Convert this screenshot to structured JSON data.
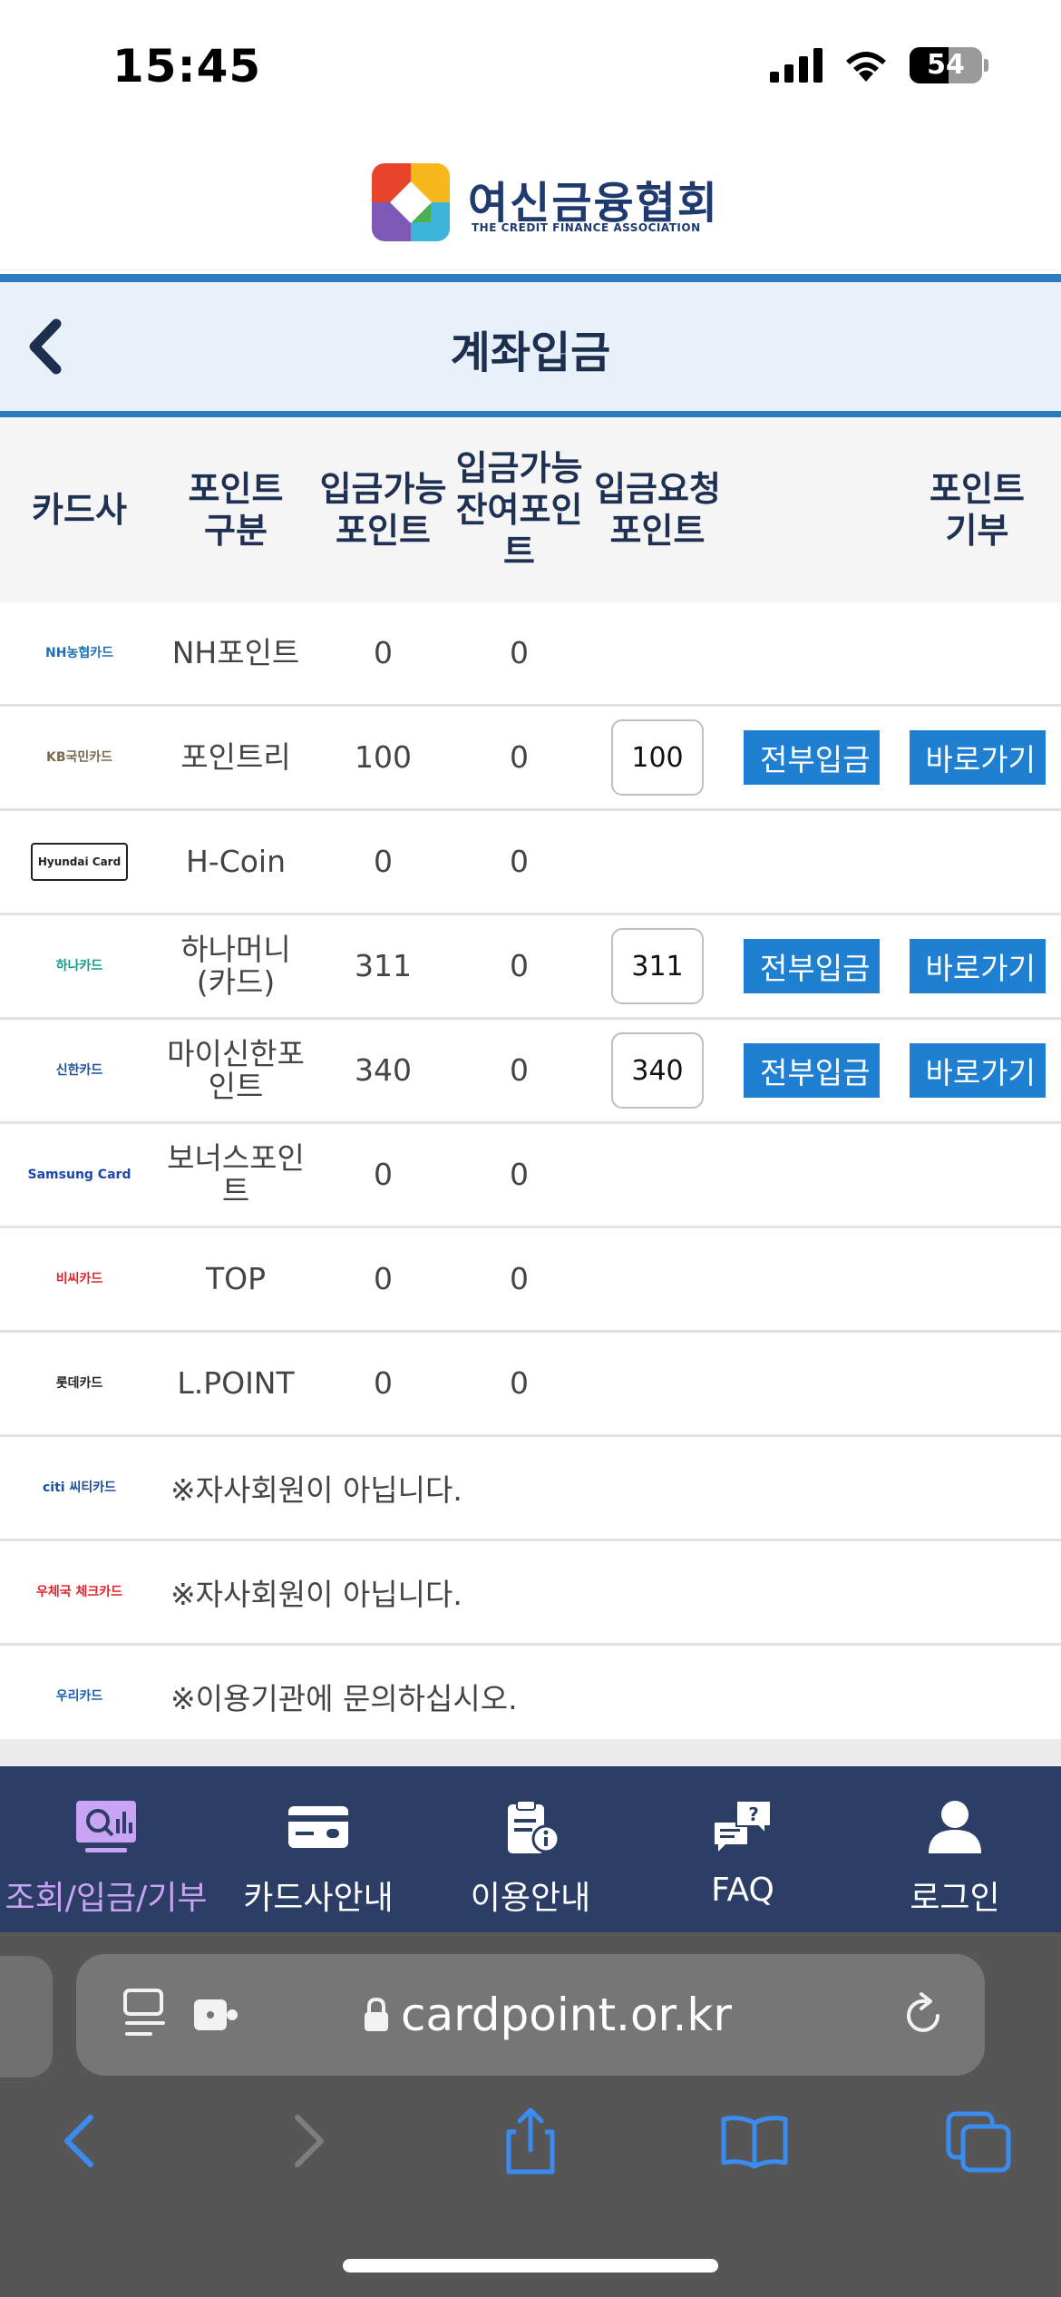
{
  "status": {
    "time": "15:45",
    "battery": "54",
    "battery_level": 0.54
  },
  "brand": {
    "name": "여신금융협회",
    "subtitle": "THE CREDIT FINANCE ASSOCIATION"
  },
  "page": {
    "title": "계좌입금"
  },
  "table": {
    "headers": {
      "card": "카드사",
      "type": [
        "포인트",
        "구분"
      ],
      "available": [
        "입금가능",
        "포인트"
      ],
      "remaining": [
        "입금가능",
        "잔여포인",
        "트"
      ],
      "request": [
        "입금요청",
        "포인트"
      ],
      "donate": [
        "포인트",
        "기부"
      ]
    },
    "rows": [
      {
        "logo": "NH농협카드",
        "logo_color": "#1f6fb5",
        "type": "NH포인트",
        "available": "0",
        "remaining": "0"
      },
      {
        "logo": "KB국민카드",
        "logo_color": "#7a6a50",
        "type": "포인트리",
        "available": "100",
        "remaining": "0",
        "request": "100",
        "all_label": "전부입금",
        "go_label": "바로가기"
      },
      {
        "logo": "Hyundai Card",
        "logo_color": "#222222",
        "type": "H-Coin",
        "available": "0",
        "remaining": "0"
      },
      {
        "logo": "하나카드",
        "logo_color": "#0f9b8e",
        "type": [
          "하나머니",
          "(카드)"
        ],
        "available": "311",
        "remaining": "0",
        "request": "311",
        "all_label": "전부입금",
        "go_label": "바로가기"
      },
      {
        "logo": "신한카드",
        "logo_color": "#1b4f9c",
        "type": [
          "마이신한포",
          "인트"
        ],
        "available": "340",
        "remaining": "0",
        "request": "340",
        "all_label": "전부입금",
        "go_label": "바로가기"
      },
      {
        "logo": "Samsung Card",
        "logo_color": "#1a48b0",
        "type": [
          "보너스포인",
          "트"
        ],
        "available": "0",
        "remaining": "0"
      },
      {
        "logo": "비씨카드",
        "logo_color": "#e0262c",
        "type": "TOP",
        "available": "0",
        "remaining": "0"
      },
      {
        "logo": "롯데카드",
        "logo_color": "#222222",
        "type": "L.POINT",
        "available": "0",
        "remaining": "0"
      },
      {
        "logo": "citi 씨티카드",
        "logo_color": "#1c4fa1",
        "notice": "※자사회원이 아닙니다."
      },
      {
        "logo": "우체국 체크카드",
        "logo_color": "#e0262c",
        "notice": "※자사회원이 아닙니다."
      },
      {
        "logo": "우리카드",
        "logo_color": "#1a5fb4",
        "notice": "※이용기관에 문의하십시오."
      }
    ]
  },
  "bottom_nav": [
    {
      "label": "조회/입금/기부",
      "icon": "chart-search-icon",
      "active": true
    },
    {
      "label": "카드사안내",
      "icon": "credit-card-icon",
      "active": false
    },
    {
      "label": "이용안내",
      "icon": "clipboard-info-icon",
      "active": false
    },
    {
      "label": "FAQ",
      "icon": "faq-chat-icon",
      "active": false
    },
    {
      "label": "로그인",
      "icon": "user-icon",
      "active": false
    }
  ],
  "browser": {
    "url": "cardpoint.or.kr"
  }
}
